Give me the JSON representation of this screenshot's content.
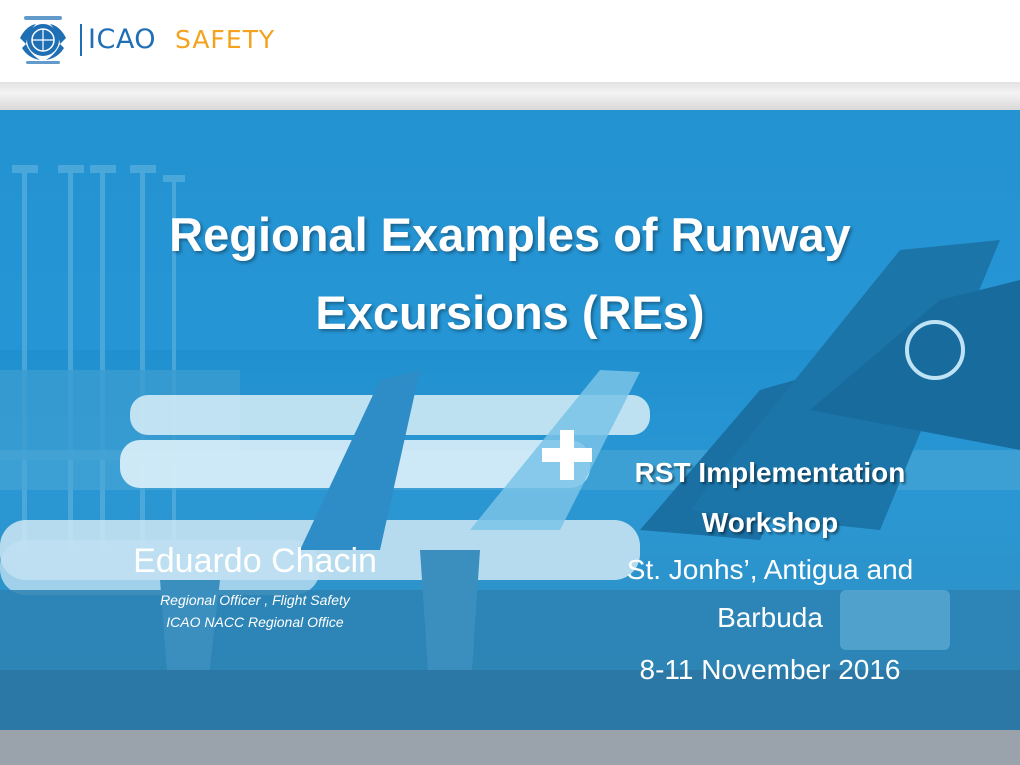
{
  "header": {
    "logo_org": "ICAO",
    "logo_program": "SAFETY"
  },
  "slide": {
    "title_line1": "Regional Examples of Runway",
    "title_line2": "Excursions (REs)",
    "presenter": {
      "name": "Eduardo Chacin",
      "role": "Regional Officer , Flight Safety",
      "office": "ICAO NACC Regional Office"
    },
    "event": {
      "workshop_line1": "RST Implementation",
      "workshop_line2": "Workshop",
      "location_line1": "St. Jonhs’, Antigua and",
      "location_line2": "Barbuda",
      "dates": "8-11 November 2016"
    }
  },
  "colors": {
    "brand_blue": "#1f6fb5",
    "safety_orange": "#f3a31d",
    "hero_blue": "#1f8fcf"
  }
}
